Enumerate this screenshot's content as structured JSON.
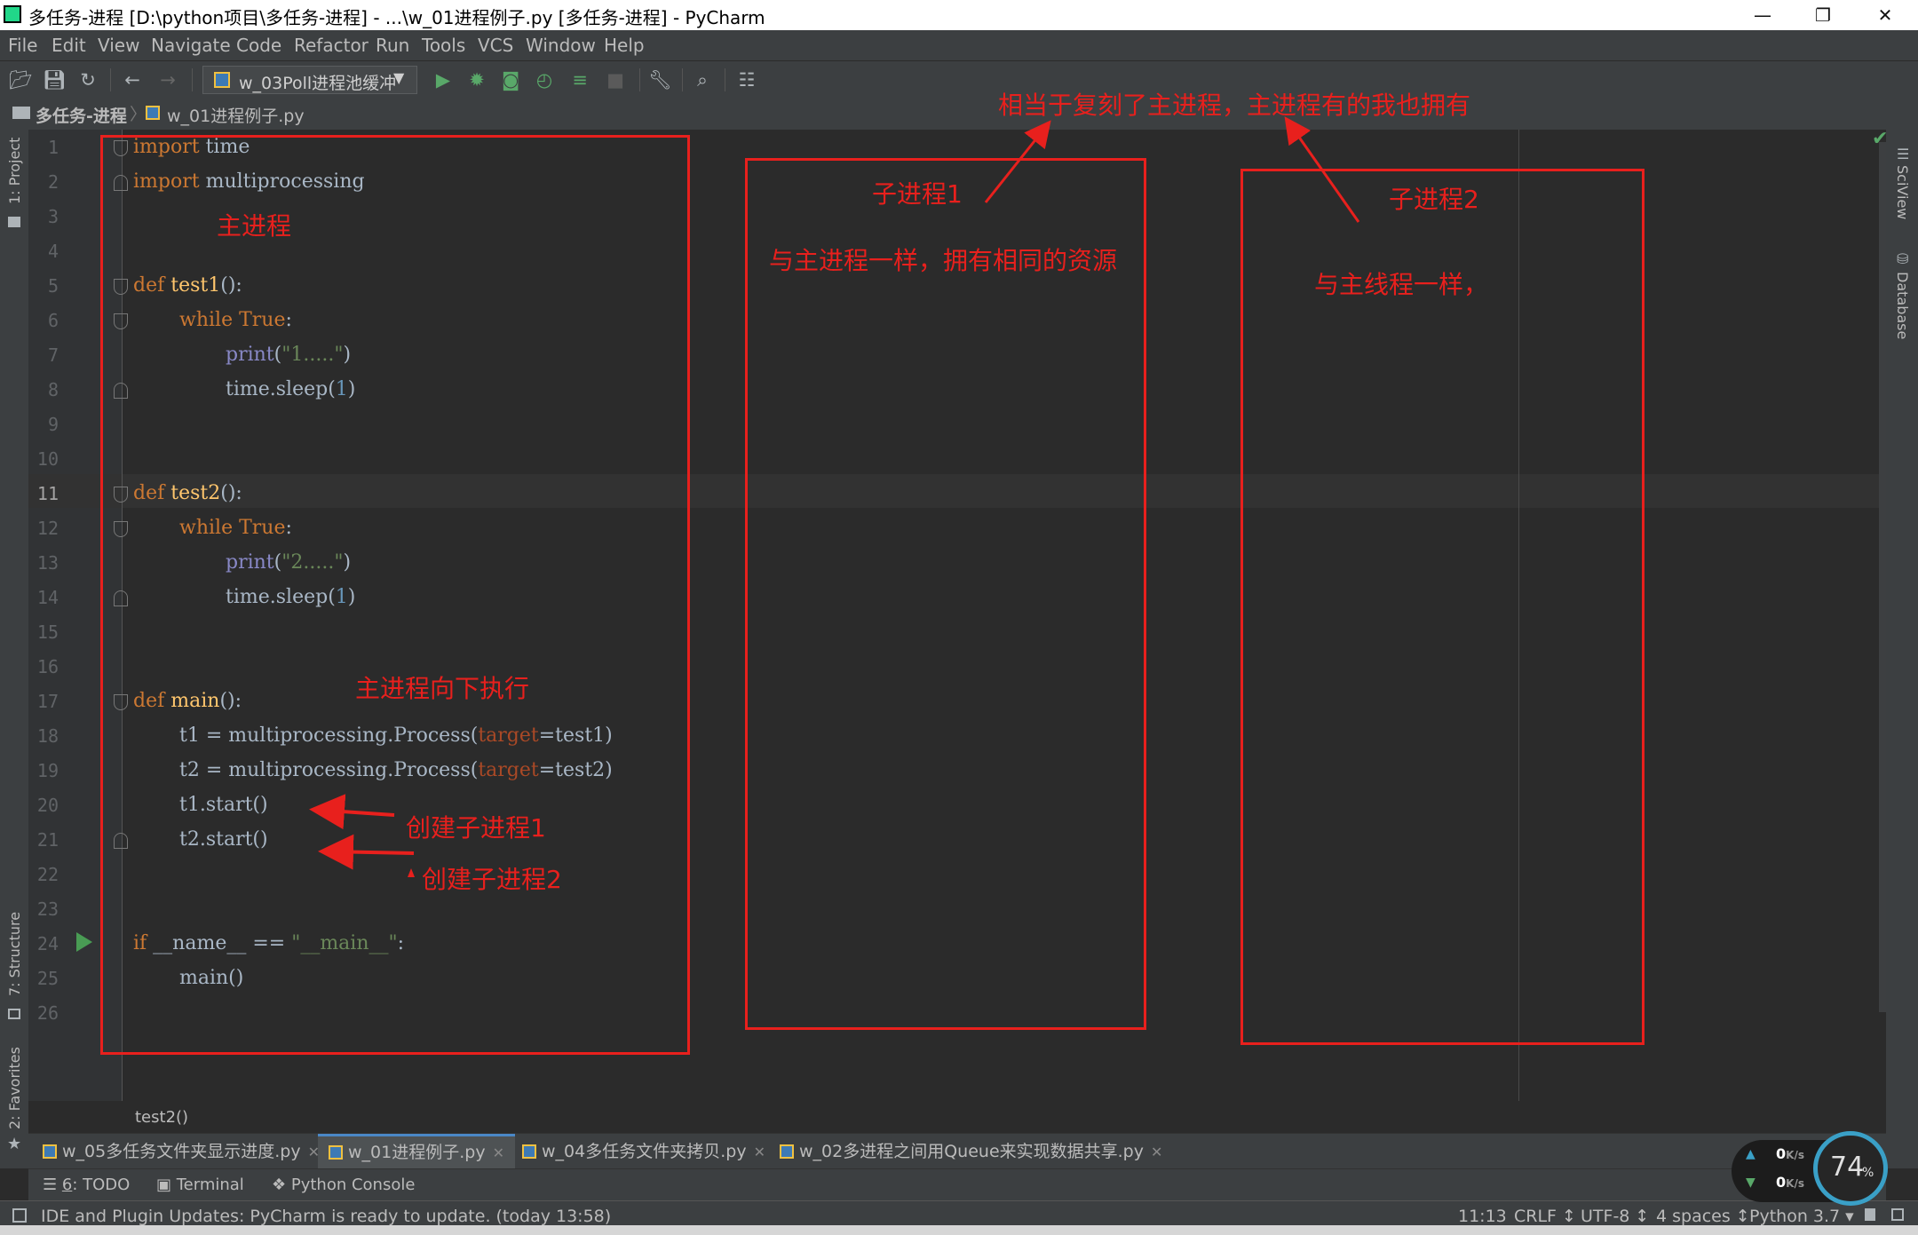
{
  "window": {
    "title": "多任务-进程 [D:\\python项目\\多任务-进程] - ...\\w_01进程例子.py [多任务-进程] - PyCharm",
    "minimize": "—",
    "restore": "❐",
    "close": "✕"
  },
  "menu": [
    "File",
    "Edit",
    "View",
    "Navigate",
    "Code",
    "Refactor",
    "Run",
    "Tools",
    "VCS",
    "Window",
    "Help"
  ],
  "toolbar": {
    "run_config": "w_03Poll进程池缓冲"
  },
  "breadcrumb": {
    "project": "多任务-进程",
    "file": "w_01进程例子.py"
  },
  "side_tools": {
    "project": "1: Project",
    "structure": "7: Structure",
    "favorites": "2: Favorites",
    "sciview": "SciView",
    "database": "Database"
  },
  "editor": {
    "line_numbers": [
      "1",
      "2",
      "3",
      "4",
      "5",
      "6",
      "7",
      "8",
      "9",
      "10",
      "11",
      "12",
      "13",
      "14",
      "15",
      "16",
      "17",
      "18",
      "19",
      "20",
      "21",
      "22",
      "23",
      "24",
      "25",
      "26"
    ],
    "current_line": "11",
    "code": {
      "l1_kw": "import",
      "l1_rest": " time",
      "l2_kw": "import",
      "l2_rest": " multiprocessing",
      "l5_kw": "def",
      "l5_fn": " test1",
      "l5_rest": "():",
      "l6_kw": "while True",
      "l6_rest": ":",
      "l7_bi": "print",
      "l7_open": "(",
      "l7_str": "\"1.....\"",
      "l7_close": ")",
      "l8_a": "time.sleep(",
      "l8_num": "1",
      "l8_b": ")",
      "l11_kw": "def",
      "l11_fn": " test2",
      "l11_rest": "():",
      "l12_kw": "while True",
      "l12_rest": ":",
      "l13_bi": "print",
      "l13_open": "(",
      "l13_str": "\"2.....\"",
      "l13_close": ")",
      "l14_a": "time.sleep(",
      "l14_num": "1",
      "l14_b": ")",
      "l17_kw": "def",
      "l17_fn": " main",
      "l17_rest": "():",
      "l18_a": "t1 = multiprocessing.Process(",
      "l18_param": "target",
      "l18_b": "=test1)",
      "l19_a": "t2 = multiprocessing.Process(",
      "l19_param": "target",
      "l19_b": "=test2)",
      "l20": "t1.start()",
      "l21": "t2.start()",
      "l24_kw": "if",
      "l24_a": " __name__ == ",
      "l24_str": "\"__main__\"",
      "l24_b": ":",
      "l25": "main()"
    },
    "crumb": "test2()"
  },
  "annotations": {
    "main_process": "主进程",
    "main_down": "主进程向下执行",
    "create1": "创建子进程1",
    "create2": "创建子进程2",
    "child1": "子进程1",
    "child1_desc": "与主进程一样，拥有相同的资源",
    "child2": "子进程2",
    "child2_desc": "与主线程一样，",
    "copy_note": "相当于复刻了主进程，主进程有的我也拥有",
    "color": "#e8201d"
  },
  "tabs": [
    {
      "label": "w_05多任务文件夹显示进度.py",
      "active": false
    },
    {
      "label": "w_01进程例子.py",
      "active": true
    },
    {
      "label": "w_04多任务文件夹拷贝.py",
      "active": false
    },
    {
      "label": "w_02多进程之间用Queue来实现数据共享.py",
      "active": false
    }
  ],
  "tool_windows": {
    "todo_num": "6",
    "todo_label": ": TODO",
    "terminal": "Terminal",
    "python_console": "Python Console"
  },
  "status": {
    "message": "IDE and Plugin Updates: PyCharm is ready to update. (today 13:58)",
    "position": "11:13",
    "line_sep": "CRLF",
    "encoding": "UTF-8",
    "indent": "4 spaces",
    "interpreter": "Python 3.7"
  },
  "net_widget": {
    "up": "0",
    "down": "0",
    "unit": "K/s",
    "percent": "74",
    "percent_sign": "%"
  }
}
